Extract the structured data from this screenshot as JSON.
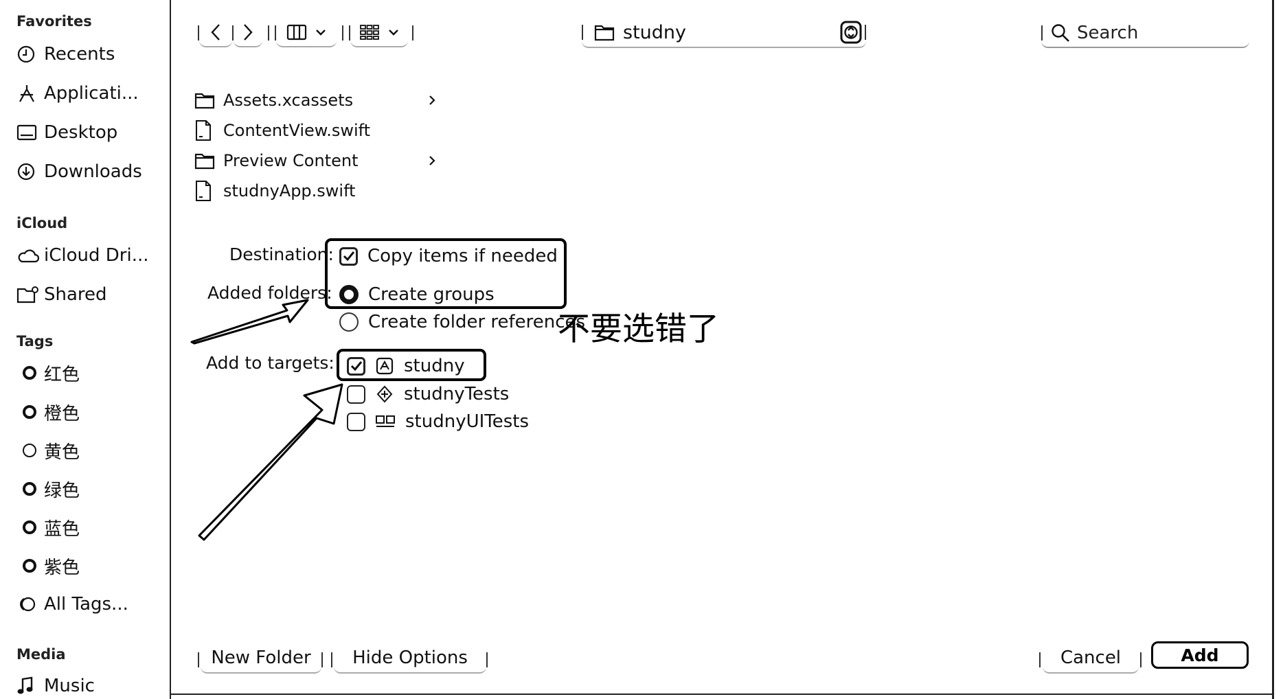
{
  "sidebar": {
    "favorites_title": "Favorites",
    "favorites": [
      {
        "label": "Recents",
        "icon": "clock-icon"
      },
      {
        "label": "Applicati...",
        "icon": "applications-icon"
      },
      {
        "label": "Desktop",
        "icon": "desktop-icon"
      },
      {
        "label": "Downloads",
        "icon": "download-icon"
      }
    ],
    "icloud_title": "iCloud",
    "icloud": [
      {
        "label": "iCloud Dri...",
        "icon": "cloud-icon"
      },
      {
        "label": "Shared",
        "icon": "shared-folder-icon"
      }
    ],
    "tags_title": "Tags",
    "tags": [
      {
        "label": "红色"
      },
      {
        "label": "橙色"
      },
      {
        "label": "黄色"
      },
      {
        "label": "绿色"
      },
      {
        "label": "蓝色"
      },
      {
        "label": "紫色"
      },
      {
        "label": "All Tags..."
      }
    ],
    "media_title": "Media",
    "media": [
      {
        "label": "Music",
        "icon": "music-note-icon"
      }
    ]
  },
  "toolbar": {
    "path_label": "studny",
    "search_placeholder": "Search"
  },
  "files": [
    {
      "name": "Assets.xcassets",
      "icon": "folder-icon",
      "has_children": true
    },
    {
      "name": "ContentView.swift",
      "icon": "file-icon",
      "has_children": false
    },
    {
      "name": "Preview Content",
      "icon": "folder-icon",
      "has_children": true
    },
    {
      "name": "studnyApp.swift",
      "icon": "file-icon",
      "has_children": false
    }
  ],
  "options": {
    "destination_label": "Destination:",
    "copy_items_label": "Copy items if needed",
    "copy_items_checked": true,
    "added_folders_label": "Added folders:",
    "create_groups_label": "Create groups",
    "create_groups_selected": true,
    "create_refs_label": "Create folder references",
    "create_refs_selected": false,
    "targets_label": "Add to targets:",
    "targets": [
      {
        "name": "studny",
        "checked": true,
        "icon": "app-target-icon"
      },
      {
        "name": "studnyTests",
        "checked": false,
        "icon": "test-target-icon"
      },
      {
        "name": "studnyUITests",
        "checked": false,
        "icon": "ui-test-target-icon"
      }
    ]
  },
  "annotation": {
    "text": "不要选错了"
  },
  "bottom": {
    "new_folder": "New Folder",
    "hide_options": "Hide Options",
    "cancel": "Cancel",
    "add": "Add"
  }
}
